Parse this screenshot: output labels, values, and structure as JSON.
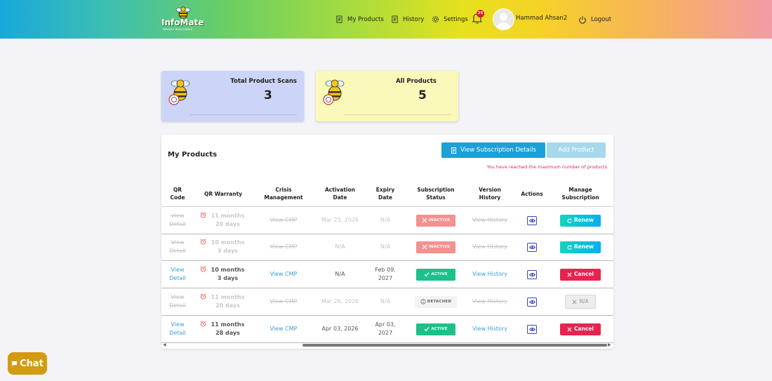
{
  "header": {
    "logo_text": "InfoMate",
    "logo_tagline": "PRODUCT INTELLIGENCE",
    "nav": [
      {
        "label": "My Products",
        "icon": "document-icon"
      },
      {
        "label": "History",
        "icon": "history-icon"
      },
      {
        "label": "Settings",
        "icon": "gear-icon"
      }
    ],
    "notification_count": "25",
    "user_name": "Hammad Ahsan2",
    "logout_label": "Logout"
  },
  "stats": [
    {
      "title": "Total Product Scans",
      "value": "3",
      "bg": "#ccd4f7"
    },
    {
      "title": "All Products",
      "value": "5",
      "bg": "#fbf9b9"
    }
  ],
  "panel": {
    "title": "My Products",
    "view_subscription_label": "View Subscription Details",
    "add_product_label": "Add Product",
    "limit_message": "You have reached the maximum number of products"
  },
  "table": {
    "headers": [
      "QR Code",
      "QR Warranty",
      "Crisis Management",
      "Activation Date",
      "Expiry Date",
      "Subscription Status",
      "Version History",
      "Actions",
      "Manage Subscription"
    ],
    "rows": [
      {
        "qr": "View Detail",
        "warranty": "11 months 20 days",
        "cmp": "View CMP",
        "activation": "Mar 25, 2026",
        "expiry": "N/A",
        "status": "INACTIVE",
        "history": "View History",
        "manage": "Renew",
        "enabled": false
      },
      {
        "qr": "View Detail",
        "warranty": "10 months 3 days",
        "cmp": "View CMP",
        "activation": "N/A",
        "expiry": "N/A",
        "status": "INACTIVE",
        "history": "View History",
        "manage": "Renew",
        "enabled": false
      },
      {
        "qr": "View Detail",
        "warranty": "10 months 3 days",
        "cmp": "View CMP",
        "activation": "N/A",
        "expiry": "Feb 09, 2027",
        "status": "ACTIVE",
        "history": "View History",
        "manage": "Cancel",
        "enabled": true
      },
      {
        "qr": "View Detail",
        "warranty": "11 months 20 days",
        "cmp": "View CMP",
        "activation": "Mar 26, 2026",
        "expiry": "N/A",
        "status": "DETACHED",
        "history": "View History",
        "manage": "N/A",
        "enabled": false
      },
      {
        "qr": "View Detail",
        "warranty": "11 months 28 days",
        "cmp": "View CMP",
        "activation": "Apr 03, 2026",
        "expiry": "Apr 03, 2027",
        "status": "ACTIVE",
        "history": "View History",
        "manage": "Cancel",
        "enabled": true
      }
    ]
  },
  "chat": {
    "label": "Chat"
  },
  "colors": {
    "accent": "#1aa1d6",
    "active": "#1dc08a",
    "inactive": "#f5908f",
    "cancel": "#e52450",
    "link": "#3a9fd0",
    "chat": "#d39b12"
  }
}
